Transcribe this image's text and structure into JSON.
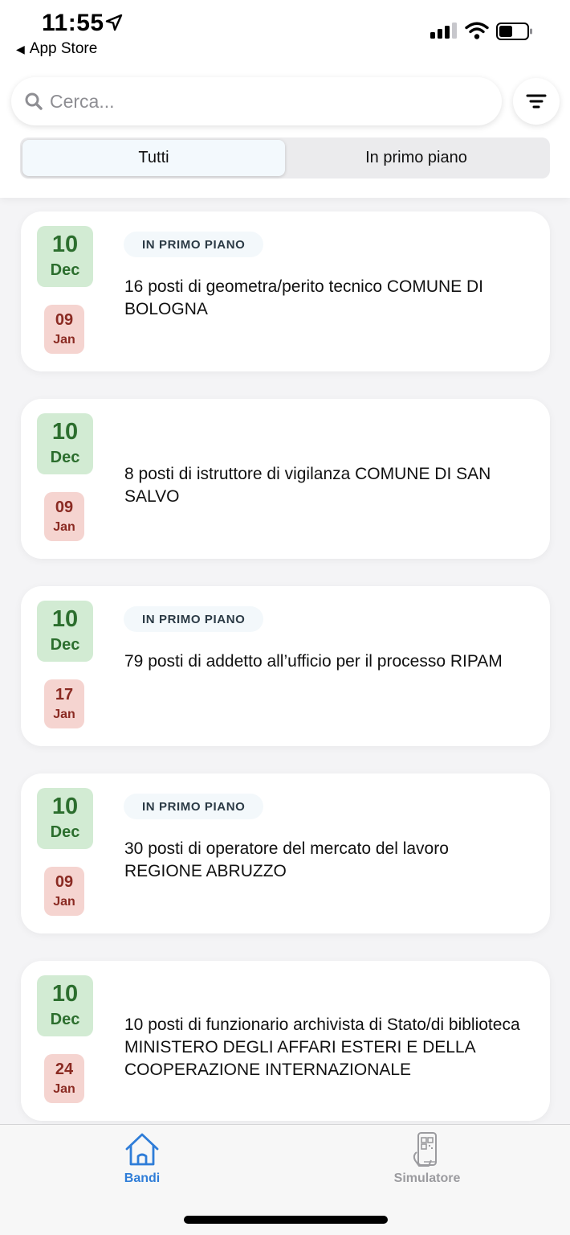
{
  "status_bar": {
    "time": "11:55",
    "back_label": "App Store"
  },
  "search": {
    "placeholder": "Cerca..."
  },
  "segments": [
    {
      "label": "Tutti",
      "active": true
    },
    {
      "label": "In primo piano",
      "active": false
    }
  ],
  "cards": [
    {
      "start_day": "10",
      "start_month": "Dec",
      "end_day": "09",
      "end_month": "Jan",
      "badge": "IN PRIMO PIANO",
      "title": "16 posti di geometra/perito tecnico COMUNE DI BOLOGNA"
    },
    {
      "start_day": "10",
      "start_month": "Dec",
      "end_day": "09",
      "end_month": "Jan",
      "badge": "",
      "title": "8 posti di istruttore di vigilanza COMUNE DI SAN SALVO"
    },
    {
      "start_day": "10",
      "start_month": "Dec",
      "end_day": "17",
      "end_month": "Jan",
      "badge": "IN PRIMO PIANO",
      "title": "79 posti di addetto all’ufficio per il processo RIPAM"
    },
    {
      "start_day": "10",
      "start_month": "Dec",
      "end_day": "09",
      "end_month": "Jan",
      "badge": "IN PRIMO PIANO",
      "title": "30 posti di operatore del mercato del lavoro REGIONE ABRUZZO"
    },
    {
      "start_day": "10",
      "start_month": "Dec",
      "end_day": "24",
      "end_month": "Jan",
      "badge": "",
      "title": "10 posti di funzionario archivista di Stato/di biblioteca MINISTERO DEGLI AFFARI ESTERI E DELLA COOPERAZIONE INTERNAZIONALE"
    }
  ],
  "tabbar": {
    "bandi_label": "Bandi",
    "simulatore_label": "Simulatore"
  },
  "colors": {
    "accent": "#2f7dd8",
    "start_date_bg": "#d2ebd3",
    "end_date_bg": "#f5d4d0"
  }
}
